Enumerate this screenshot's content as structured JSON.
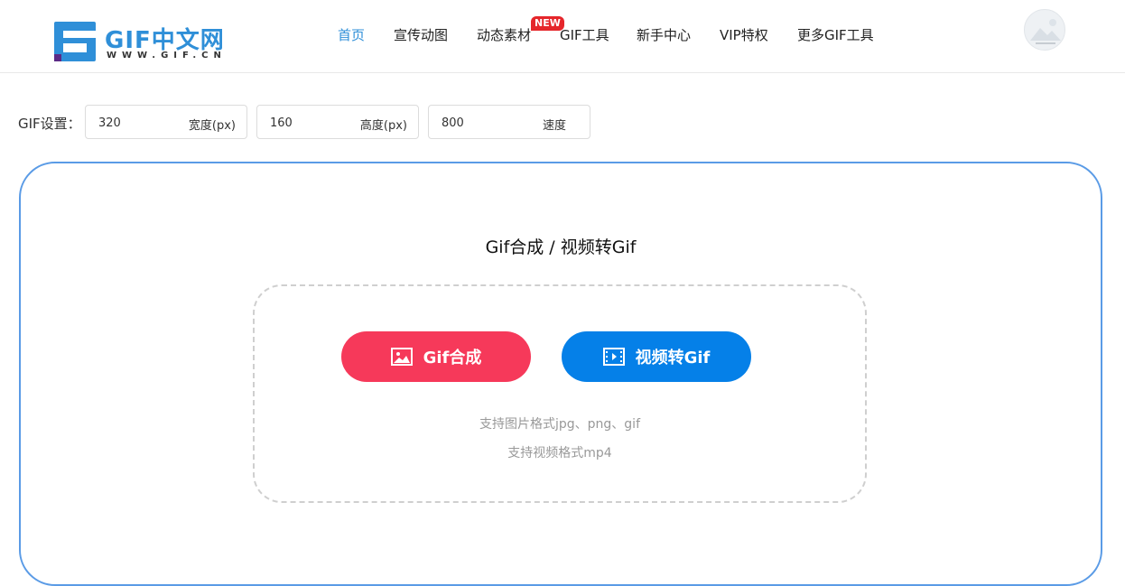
{
  "header": {
    "logo": {
      "title": "GIF中文网",
      "subtitle": "WWW.GIF.CN"
    },
    "nav": [
      {
        "label": "首页",
        "active": true
      },
      {
        "label": "宣传动图",
        "active": false
      },
      {
        "label": "动态素材",
        "active": false,
        "badge": "NEW"
      },
      {
        "label": "GIF工具",
        "active": false
      },
      {
        "label": "新手中心",
        "active": false
      },
      {
        "label": "VIP特权",
        "active": false
      },
      {
        "label": "更多GIF工具",
        "active": false
      }
    ],
    "avatar_icon": "avatar-placeholder-icon"
  },
  "settings": {
    "label": "GIF设置：",
    "width": {
      "value": "320",
      "unit": "宽度(px)"
    },
    "height": {
      "value": "160",
      "unit": "高度(px)"
    },
    "speed": {
      "value": "800",
      "unit": "速度"
    }
  },
  "main": {
    "title": "Gif合成 / 视频转Gif",
    "gif_button": {
      "label": "Gif合成",
      "icon": "image-icon"
    },
    "video_button": {
      "label": "视频转Gif",
      "icon": "film-icon"
    },
    "hint_image": "支持图片格式jpg、png、gif",
    "hint_video": "支持视频格式mp4"
  },
  "colors": {
    "accent": "#2f8fd8",
    "gif_button": "#f6395a",
    "video_button": "#0580e8",
    "card_border": "#5a9be6",
    "badge": "#e5262b"
  }
}
